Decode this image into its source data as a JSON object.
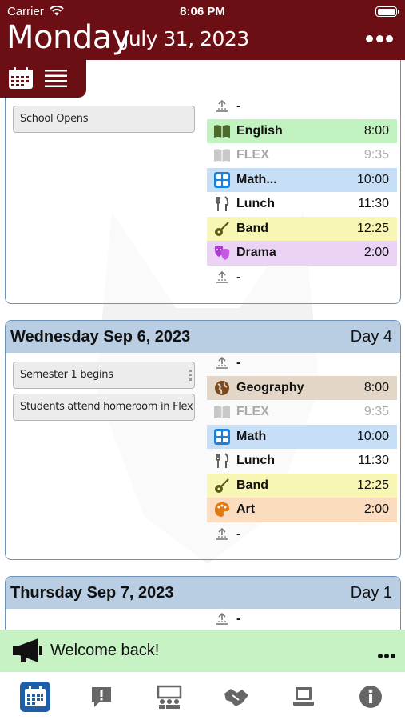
{
  "status_bar": {
    "carrier": "Carrier",
    "time": "8:06 PM"
  },
  "header": {
    "day": "Monday",
    "date": "July 31, 2023",
    "more_icon": "ellipsis-icon"
  },
  "view_toggle": {
    "calendar_icon": "calendar-icon",
    "list_icon": "list-icon"
  },
  "colors": {
    "header_bg": "#6b0f14",
    "card_head_bg": "#b9cee3",
    "english": "#c3f2c1",
    "math": "#c6dff7",
    "band": "#f8f6b5",
    "drama": "#ead3f5",
    "geography": "#e4d6c6",
    "art": "#fcdcbf",
    "banner": "#c6f2c4",
    "active_tab": "#1e5fa8"
  },
  "day1": {
    "events": [
      {
        "label": "School Opens"
      }
    ],
    "periods": [
      {
        "icon": "start-icon",
        "name": "-",
        "time": ""
      },
      {
        "icon": "book-icon",
        "name": "English",
        "time": "8:00",
        "color": "#c3f2c1"
      },
      {
        "icon": "book-icon",
        "name": "FLEX",
        "time": "9:35",
        "dim": true
      },
      {
        "icon": "grid-icon",
        "name": "Math...",
        "time": "10:00",
        "color": "#c6dff7"
      },
      {
        "icon": "fork-knife-icon",
        "name": "Lunch",
        "time": "11:30"
      },
      {
        "icon": "guitar-icon",
        "name": "Band",
        "time": "12:25",
        "color": "#f8f6b5"
      },
      {
        "icon": "drama-masks-icon",
        "name": "Drama",
        "time": "2:00",
        "color": "#ead3f5"
      },
      {
        "icon": "end-icon",
        "name": "-",
        "time": ""
      }
    ]
  },
  "day2": {
    "heading": "Wednesday Sep 6, 2023",
    "cycle_day": "Day 4",
    "events": [
      {
        "label": "Semester 1 begins"
      },
      {
        "label": "Students attend homeroom in Flex"
      }
    ],
    "periods": [
      {
        "icon": "start-icon",
        "name": "-",
        "time": ""
      },
      {
        "icon": "globe-icon",
        "name": "Geography",
        "time": "8:00",
        "color": "#e4d6c6"
      },
      {
        "icon": "book-icon",
        "name": "FLEX",
        "time": "9:35",
        "dim": true
      },
      {
        "icon": "grid-icon",
        "name": "Math",
        "time": "10:00",
        "color": "#c6dff7"
      },
      {
        "icon": "fork-knife-icon",
        "name": "Lunch",
        "time": "11:30"
      },
      {
        "icon": "guitar-icon",
        "name": "Band",
        "time": "12:25",
        "color": "#f8f6b5"
      },
      {
        "icon": "palette-icon",
        "name": "Art",
        "time": "2:00",
        "color": "#fcdcbf"
      },
      {
        "icon": "end-icon",
        "name": "-",
        "time": ""
      }
    ]
  },
  "day3": {
    "heading": "Thursday Sep 7, 2023",
    "cycle_day": "Day 1",
    "periods": [
      {
        "icon": "start-icon",
        "name": "-",
        "time": ""
      }
    ]
  },
  "banner": {
    "text": "Welcome back!",
    "icon": "megaphone-icon"
  },
  "tabbar": {
    "tabs": [
      {
        "icon": "calendar-icon",
        "active": true
      },
      {
        "icon": "alert-icon"
      },
      {
        "icon": "classroom-icon"
      },
      {
        "icon": "handshake-icon"
      },
      {
        "icon": "laptop-icon"
      },
      {
        "icon": "info-icon"
      }
    ]
  }
}
